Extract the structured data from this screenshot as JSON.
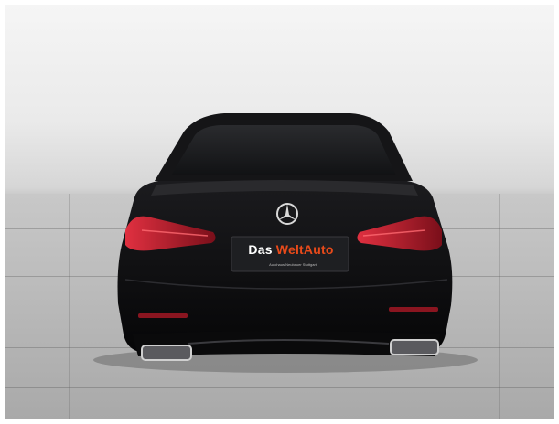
{
  "plate": {
    "dealer_prefix": "Das ",
    "dealer_brand": "WeltAuto",
    "dealer_sub": "Autohaus Neubauer Stuttgart"
  },
  "colors": {
    "car_body": "#0e0e10",
    "tail_light": "#c0182c",
    "plate_brand": "#e84a1a",
    "chrome": "#c8c8c8"
  },
  "icons": {
    "emblem": "mercedes-star-icon"
  }
}
